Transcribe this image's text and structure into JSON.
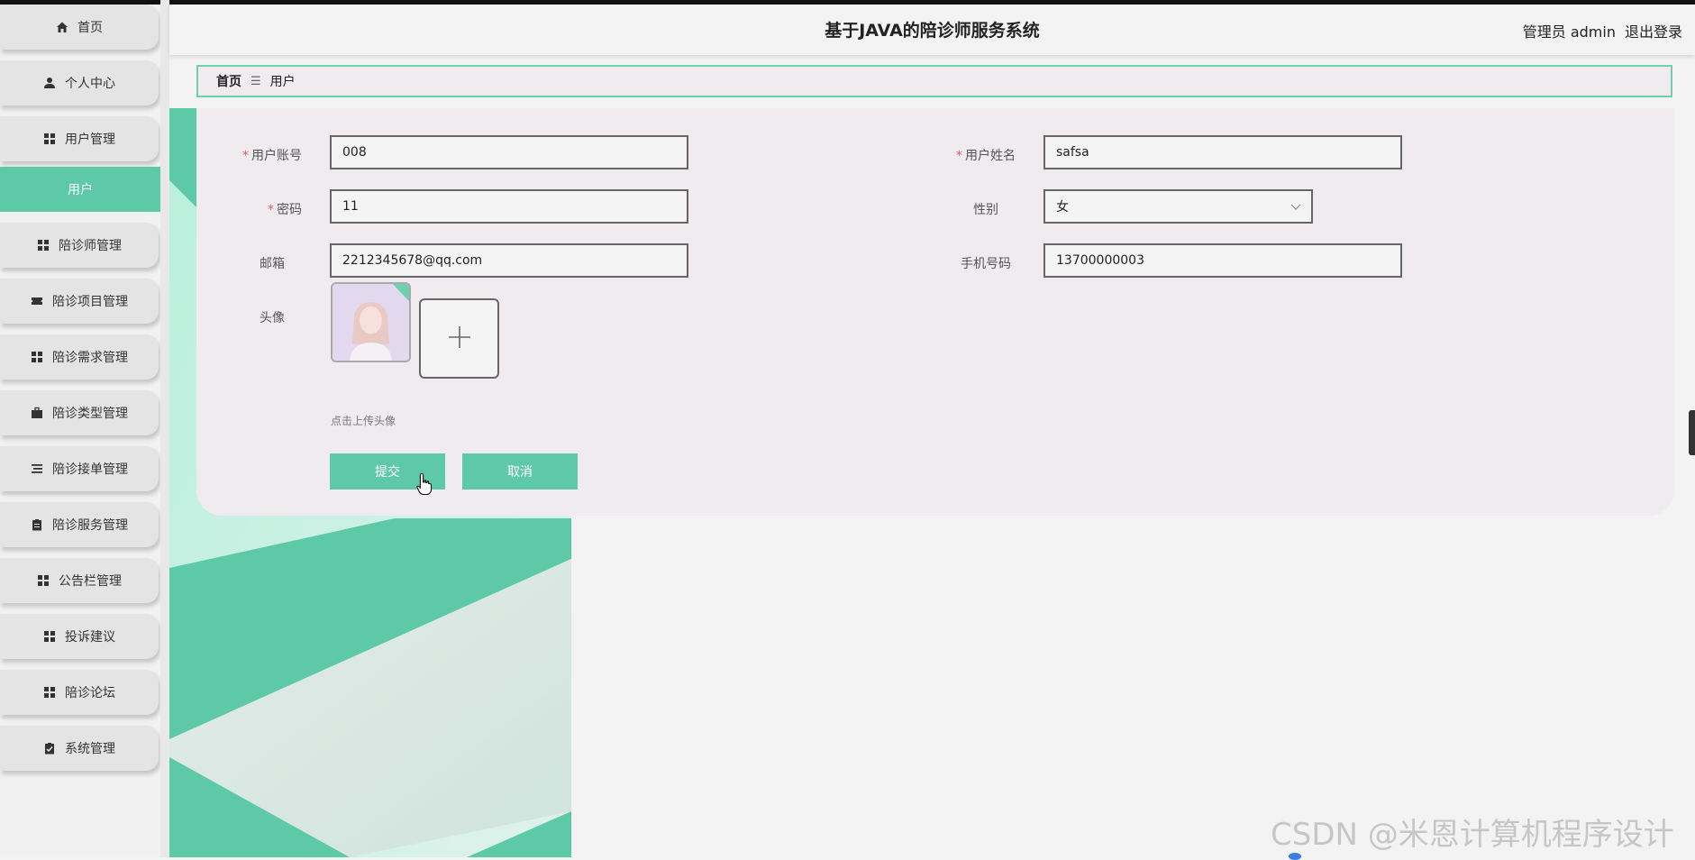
{
  "header": {
    "title": "基于JAVA的陪诊师服务系统",
    "role": "管理员 admin",
    "logout": "退出登录"
  },
  "sidebar": {
    "items": [
      {
        "label": "首页",
        "icon": "home-icon"
      },
      {
        "label": "个人中心",
        "icon": "user-icon"
      },
      {
        "label": "用户管理",
        "icon": "grid-icon"
      },
      {
        "label": "陪诊师管理",
        "icon": "grid-icon"
      },
      {
        "label": "陪诊项目管理",
        "icon": "ticket-icon"
      },
      {
        "label": "陪诊需求管理",
        "icon": "grid-icon"
      },
      {
        "label": "陪诊类型管理",
        "icon": "briefcase-icon"
      },
      {
        "label": "陪诊接单管理",
        "icon": "list-icon"
      },
      {
        "label": "陪诊服务管理",
        "icon": "clipboard-icon"
      },
      {
        "label": "公告栏管理",
        "icon": "grid-icon"
      },
      {
        "label": "投诉建议",
        "icon": "grid-icon"
      },
      {
        "label": "陪诊论坛",
        "icon": "grid-icon"
      },
      {
        "label": "系统管理",
        "icon": "clipboard-check-icon"
      }
    ],
    "active_sub": "用户"
  },
  "breadcrumb": {
    "home": "首页",
    "separator": "☰",
    "current": "用户"
  },
  "form": {
    "account": {
      "label": "用户账号",
      "value": "008"
    },
    "name": {
      "label": "用户姓名",
      "value": "safsa"
    },
    "password": {
      "label": "密码",
      "value": "11"
    },
    "gender": {
      "label": "性别",
      "value": "女"
    },
    "email": {
      "label": "邮箱",
      "value": "2212345678@qq.com"
    },
    "phone": {
      "label": "手机号码",
      "value": "13700000003"
    },
    "avatar": {
      "label": "头像",
      "upload_tip": "点击上传头像"
    },
    "required_mark": "*",
    "submit": "提交",
    "cancel": "取消"
  },
  "watermark": "CSDN @米恩计算机程序设计",
  "colors": {
    "accent": "#5ec9a6",
    "card_bg": "#efebef",
    "required": "#e06060"
  }
}
